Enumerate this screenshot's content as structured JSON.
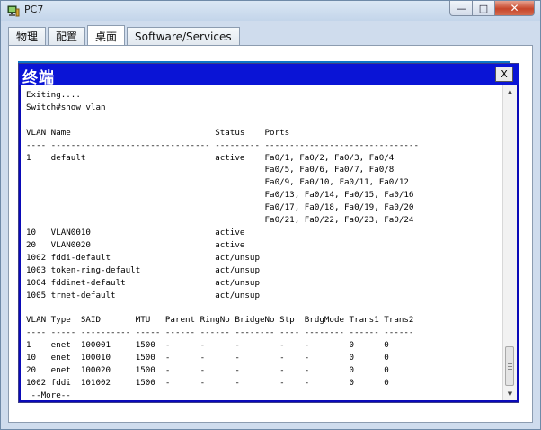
{
  "window": {
    "title": "PC7",
    "buttons": {
      "minimize": "—",
      "maximize": "□",
      "close": "✕"
    }
  },
  "tabs": [
    {
      "label": "物理"
    },
    {
      "label": "配置"
    },
    {
      "label": "桌面",
      "active": true
    },
    {
      "label": "Software/Services"
    }
  ],
  "terminal": {
    "title": "终端",
    "close_label": "X",
    "lines": [
      "Exiting....",
      "Switch#show vlan",
      "",
      "VLAN Name                             Status    Ports",
      "---- -------------------------------- --------- -------------------------------",
      "1    default                          active    Fa0/1, Fa0/2, Fa0/3, Fa0/4",
      "                                                Fa0/5, Fa0/6, Fa0/7, Fa0/8",
      "                                                Fa0/9, Fa0/10, Fa0/11, Fa0/12",
      "                                                Fa0/13, Fa0/14, Fa0/15, Fa0/16",
      "                                                Fa0/17, Fa0/18, Fa0/19, Fa0/20",
      "                                                Fa0/21, Fa0/22, Fa0/23, Fa0/24",
      "10   VLAN0010                         active",
      "20   VLAN0020                         active",
      "1002 fddi-default                     act/unsup",
      "1003 token-ring-default               act/unsup",
      "1004 fddinet-default                  act/unsup",
      "1005 trnet-default                    act/unsup",
      "",
      "VLAN Type  SAID       MTU   Parent RingNo BridgeNo Stp  BrdgMode Trans1 Trans2",
      "---- ----- ---------- ----- ------ ------ -------- ---- -------- ------ ------",
      "1    enet  100001     1500  -      -      -        -    -        0      0",
      "10   enet  100010     1500  -      -      -        -    -        0      0",
      "20   enet  100020     1500  -      -      -        -    -        0      0",
      "1002 fddi  101002     1500  -      -      -        -    -        0      0",
      " --More--"
    ]
  }
}
